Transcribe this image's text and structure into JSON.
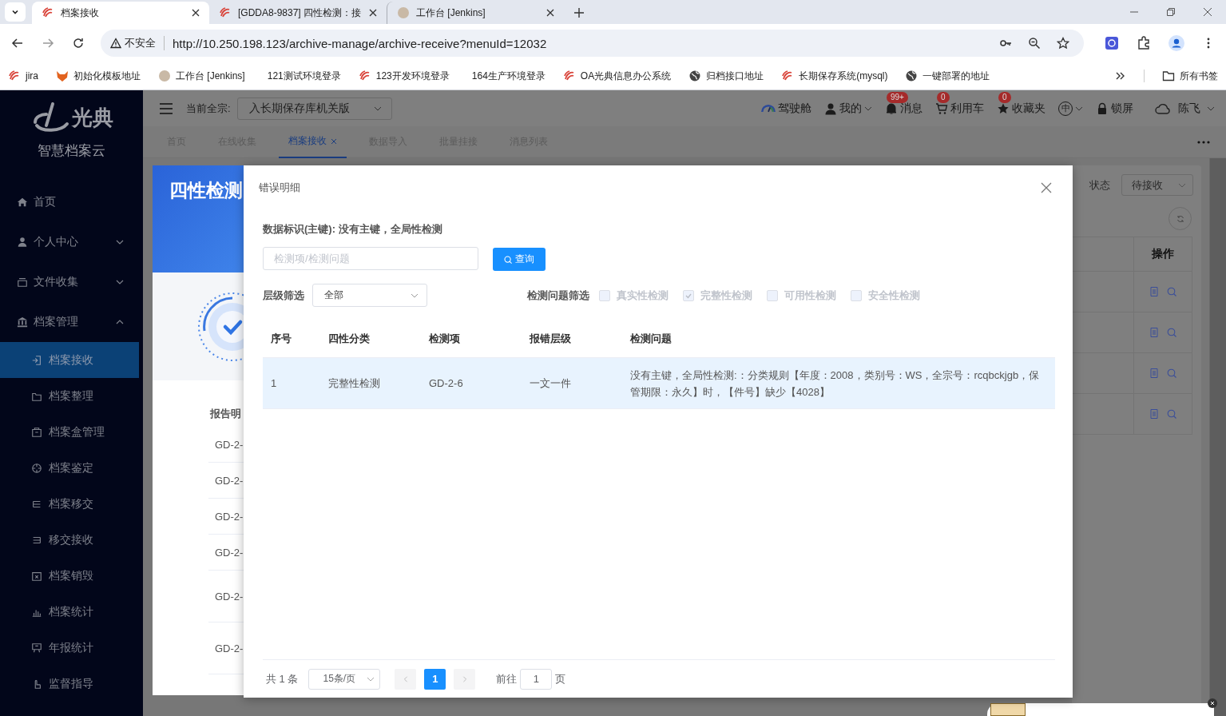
{
  "browser": {
    "tabs": [
      {
        "title": "档案接收",
        "selected": true
      },
      {
        "title": "[GDDA8-9837] 四性检测：接",
        "selected": false
      },
      {
        "title": "工作台 [Jenkins]",
        "selected": false
      }
    ],
    "address_bar": {
      "security_label": "不安全",
      "url": "http://10.250.198.123/archive-manage/archive-receive?menuId=12032"
    },
    "bookmarks": [
      {
        "label": "jira"
      },
      {
        "label": "初始化模板地址"
      },
      {
        "label": "工作台 [Jenkins]"
      },
      {
        "label": "121测试环境登录"
      },
      {
        "label": "123开发环境登录"
      },
      {
        "label": "164生产环境登录"
      },
      {
        "label": "OA光典信息办公系统"
      },
      {
        "label": "归档接口地址"
      },
      {
        "label": "长期保存系统(mysql)"
      },
      {
        "label": "一键部署的地址"
      }
    ],
    "all_bookmarks": "所有书签"
  },
  "sidebar": {
    "logo_text": "光典",
    "brand": "智慧档案云",
    "items": [
      {
        "label": "首页"
      },
      {
        "label": "个人中心",
        "expanded": false
      },
      {
        "label": "文件收集",
        "expanded": false
      },
      {
        "label": "档案管理",
        "expanded": true,
        "children": [
          {
            "label": "档案接收",
            "selected": true
          },
          {
            "label": "档案整理",
            "selected": false
          },
          {
            "label": "档案盒管理",
            "selected": false
          },
          {
            "label": "档案鉴定",
            "selected": false
          },
          {
            "label": "档案移交",
            "selected": false
          },
          {
            "label": "移交接收",
            "selected": false
          },
          {
            "label": "档案销毁",
            "selected": false
          },
          {
            "label": "档案统计",
            "selected": false
          },
          {
            "label": "年报统计",
            "selected": false
          },
          {
            "label": "监督指导",
            "selected": false
          }
        ]
      }
    ]
  },
  "header": {
    "scope_label": "当前全宗:",
    "scope_value": "入长期保存库机关版",
    "actions": [
      {
        "kind": "dashboard",
        "label": "驾驶舱"
      },
      {
        "kind": "user",
        "label": "我的"
      },
      {
        "kind": "bell",
        "label": "消息",
        "badge": "99+"
      },
      {
        "kind": "cart",
        "label": "利用车",
        "badge": "0"
      },
      {
        "kind": "star",
        "label": "收藏夹",
        "badge": "0"
      },
      {
        "kind": "language",
        "label": "中"
      },
      {
        "kind": "lock",
        "label": "锁屏"
      }
    ],
    "user": "陈飞"
  },
  "page_tabs": [
    {
      "label": "首页",
      "selected": false,
      "closable": false
    },
    {
      "label": "在线收集",
      "selected": false,
      "closable": false
    },
    {
      "label": "档案接收",
      "selected": true,
      "closable": true
    },
    {
      "label": "数据导入",
      "selected": false,
      "closable": false
    },
    {
      "label": "批量挂接",
      "selected": false,
      "closable": false
    },
    {
      "label": "消息列表",
      "selected": false,
      "closable": false
    }
  ],
  "report_card": {
    "title": "四性检测",
    "section_title": "报告明",
    "rows": [
      "GD-2-",
      "GD-2-",
      "GD-2-",
      "GD-2-",
      "GD-2-",
      "GD-2-"
    ]
  },
  "right_panel": {
    "status_label": "状态",
    "status_value": "待接收",
    "column": "操作",
    "rows": [
      {
        "kind": "actions"
      },
      {
        "kind": "actions"
      },
      {
        "kind": "actions"
      },
      {
        "kind": "actions"
      }
    ]
  },
  "modal": {
    "title": "错误明细",
    "info": "数据标识(主键): 没有主键，全局性检测",
    "search": {
      "placeholder": "检测项/检测问题"
    },
    "search_button": "查询",
    "level_filter": {
      "label": "层级筛选",
      "value": "全部"
    },
    "issue_filter": {
      "label": "检测问题筛选",
      "options": [
        {
          "label": "真实性检测",
          "checked": false,
          "disabled": true
        },
        {
          "label": "完整性检测",
          "checked": true,
          "disabled": true
        },
        {
          "label": "可用性检测",
          "checked": false,
          "disabled": true
        },
        {
          "label": "安全性检测",
          "checked": false,
          "disabled": true
        }
      ]
    },
    "table": {
      "columns": [
        "序号",
        "四性分类",
        "检测项",
        "报错层级",
        "检测问题"
      ],
      "rows": [
        {
          "selected": true,
          "cells": [
            "1",
            "完整性检测",
            "GD-2-6",
            "一文一件",
            "没有主键，全局性检测:：分类规则【年度：2008，类别号：WS，全宗号：rcqbckjgb，保管期限：永久】时，【件号】缺少【4028】"
          ]
        }
      ]
    },
    "pagination": {
      "total": "共 1 条",
      "page_size": "15条/页",
      "pages": [
        {
          "label": "1",
          "selected": true
        }
      ],
      "goto_label": "前往",
      "goto_value": "1",
      "page_suffix": "页"
    }
  }
}
